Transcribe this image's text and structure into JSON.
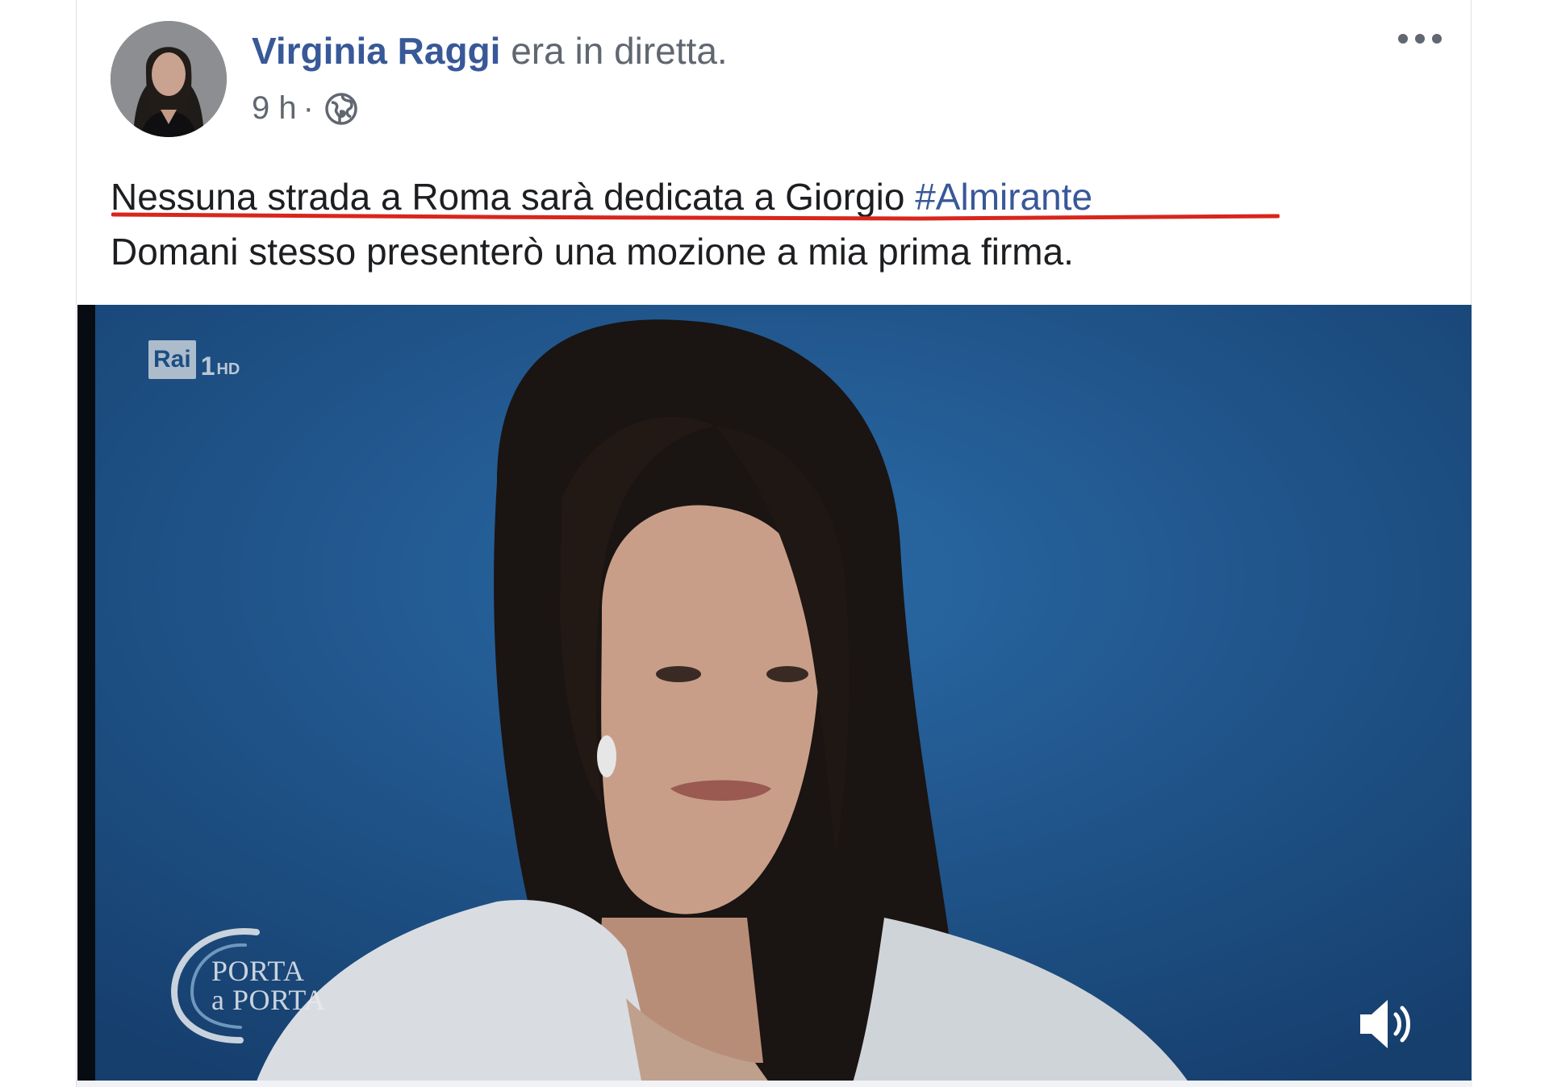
{
  "post": {
    "author": "Virginia Raggi",
    "status": " era in diretta.",
    "time": "9 h",
    "separator": "·",
    "privacy_icon": "globe-icon",
    "more_icon": "more-options-icon",
    "text_line1": "Nessuna strada a Roma sarà dedicata a Giorgio ",
    "hashtag": "#Almirante",
    "text_line2": "Domani stesso presenterò una mozione a mia prima firma."
  },
  "video": {
    "channel_box": "Rai",
    "channel_number": "1",
    "channel_hd": "HD",
    "show_logo_line1": "PORTA",
    "show_logo_line2": "a PORTA",
    "volume_icon": "volume-icon"
  },
  "colors": {
    "link": "#385898",
    "text": "#1c1e21",
    "secondary": "#616770",
    "underline_annotation": "#d8261c",
    "video_background": "#1b4f85"
  }
}
